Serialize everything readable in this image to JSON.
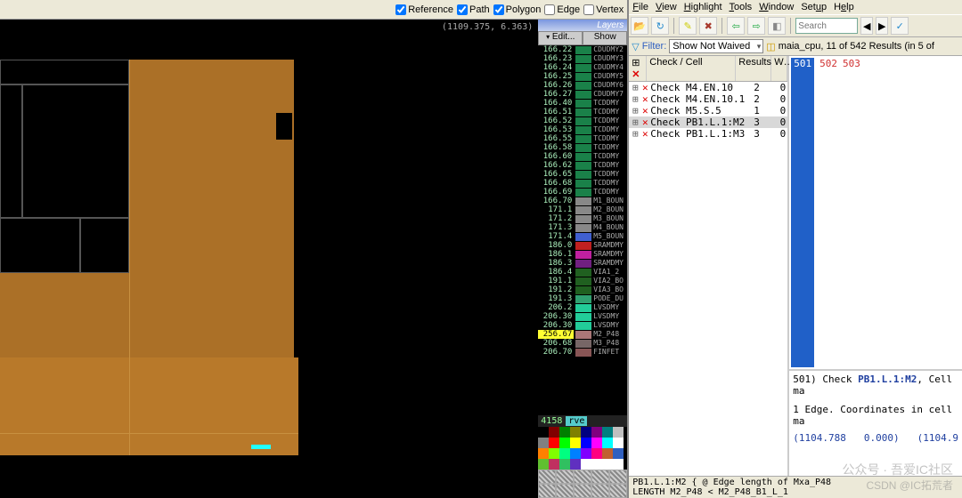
{
  "left": {
    "display_opts": [
      {
        "label": "Reference",
        "checked": true
      },
      {
        "label": "Path",
        "checked": true
      },
      {
        "label": "Polygon",
        "checked": true
      },
      {
        "label": "Edge",
        "checked": false
      },
      {
        "label": "Vertex",
        "checked": false
      }
    ],
    "coords": "(1109.375, 6.363)",
    "layers_title": "Layers",
    "layer_tabs": [
      "Edit...",
      "Show"
    ],
    "layer_rows": [
      {
        "n": "166.22",
        "c": "#1a8149",
        "nm": "CDUDMY2"
      },
      {
        "n": "166.23",
        "c": "#1a8149",
        "nm": "CDUDMY3"
      },
      {
        "n": "166.24",
        "c": "#1a8149",
        "nm": "CDUDMY4"
      },
      {
        "n": "166.25",
        "c": "#1a8149",
        "nm": "CDUDMY5"
      },
      {
        "n": "166.26",
        "c": "#1a8149",
        "nm": "CDUDMY6"
      },
      {
        "n": "166.27",
        "c": "#1a8149",
        "nm": "CDUDMY7"
      },
      {
        "n": "166.40",
        "c": "#1a8149",
        "nm": "TCDDMY"
      },
      {
        "n": "166.51",
        "c": "#1a8149",
        "nm": "TCDDMY"
      },
      {
        "n": "166.52",
        "c": "#1a8149",
        "nm": "TCDDMY"
      },
      {
        "n": "166.53",
        "c": "#1a8149",
        "nm": "TCDDMY"
      },
      {
        "n": "166.55",
        "c": "#1a8149",
        "nm": "TCDDMY"
      },
      {
        "n": "166.58",
        "c": "#1a8149",
        "nm": "TCDDMY"
      },
      {
        "n": "166.60",
        "c": "#1a8149",
        "nm": "TCDDMY"
      },
      {
        "n": "166.62",
        "c": "#1a8149",
        "nm": "TCDDMY"
      },
      {
        "n": "166.65",
        "c": "#1a8149",
        "nm": "TCDDMY"
      },
      {
        "n": "166.68",
        "c": "#1a8149",
        "nm": "TCDDMY"
      },
      {
        "n": "166.69",
        "c": "#1a8149",
        "nm": "TCDDMY"
      },
      {
        "n": "166.70",
        "c": "#888",
        "nm": "M1_BOUN"
      },
      {
        "n": "171.1",
        "c": "#888",
        "nm": "M2_BOUN"
      },
      {
        "n": "171.2",
        "c": "#888",
        "nm": "M3_BOUN"
      },
      {
        "n": "171.3",
        "c": "#888",
        "nm": "M4_BOUN"
      },
      {
        "n": "171.4",
        "c": "#4060d0",
        "nm": "M5_BOUN"
      },
      {
        "n": "186.0",
        "c": "#c02020",
        "nm": "SRAMDMY"
      },
      {
        "n": "186.1",
        "c": "#c020a0",
        "nm": "SRAMDMY"
      },
      {
        "n": "186.3",
        "c": "#702080",
        "nm": "SRAMDMY"
      },
      {
        "n": "186.4",
        "c": "#206020",
        "nm": "VIA1_2"
      },
      {
        "n": "191.1",
        "c": "#206020",
        "nm": "VIA2_BO"
      },
      {
        "n": "191.2",
        "c": "#206020",
        "nm": "VIA3_BO"
      },
      {
        "n": "191.3",
        "c": "#30a070",
        "nm": "PODE_DU"
      },
      {
        "n": "206.2",
        "c": "#2c9",
        "nm": "LVSDMY"
      },
      {
        "n": "206.30",
        "c": "#2c9",
        "nm": "LVSDMY"
      },
      {
        "n": "206.30",
        "c": "#2c9",
        "nm": "LVSDMY"
      },
      {
        "n": "256.67",
        "c": "#a77",
        "nm": "M2_P48",
        "sel": true
      },
      {
        "n": "206.68",
        "c": "#766",
        "nm": "M3_P48"
      },
      {
        "n": "206.70",
        "c": "#855",
        "nm": "FINFET"
      }
    ],
    "layer_count": "4158",
    "layer_count_tag": "rve",
    "palette": [
      "#000",
      "#800000",
      "#008000",
      "#808000",
      "#000080",
      "#800080",
      "#008080",
      "#c0c0c0",
      "#808080",
      "#ff0000",
      "#00ff00",
      "#ffff00",
      "#0000ff",
      "#ff00ff",
      "#00ffff",
      "#ffffff",
      "#ff8000",
      "#80ff00",
      "#00ff80",
      "#0080ff",
      "#8000ff",
      "#ff0080",
      "#c06030",
      "#3060c0",
      "#60c030",
      "#c03060",
      "#30c060",
      "#6030c0",
      "#fff",
      "#fff",
      "#fff",
      "#fff"
    ]
  },
  "rve": {
    "menus": [
      "File",
      "View",
      "Highlight",
      "Tools",
      "Window",
      "Setup",
      "Help"
    ],
    "toolbar_icons": [
      "folder-open-icon",
      "refresh-icon",
      "highlight-icon",
      "erase-icon",
      "zoom-fit-icon",
      "arrow-prev-icon",
      "arrow-next-icon",
      "unhilite-icon"
    ],
    "search_placeholder": "Search",
    "nav_icons": [
      "nav-prev-icon",
      "nav-next-icon",
      "waive-icon"
    ],
    "filter_label": "Filter:",
    "filter_value": "Show Not Waived",
    "cell_icon": "cell-icon",
    "context": "maia_cpu, 11 of 542 Results (in 5 of",
    "check_header": {
      "col1": "Check / Cell",
      "col2": "Results",
      "col3": "W…"
    },
    "checks": [
      {
        "name": "Check M4.EN.10",
        "res": "2",
        "w": "0"
      },
      {
        "name": "Check M4.EN.10.1",
        "res": "2",
        "w": "0"
      },
      {
        "name": "Check M5.S.5",
        "res": "1",
        "w": "0"
      },
      {
        "name": "Check PB1.L.1:M2",
        "res": "3",
        "w": "0",
        "sel": true
      },
      {
        "name": "Check PB1.L.1:M3",
        "res": "3",
        "w": "0"
      }
    ],
    "result_ids": [
      "501",
      "502",
      "503"
    ],
    "detail_line1": "501) Check PB1.L.1:M2, Cell ma",
    "detail_line2": "1 Edge. Coordinates in cell ma",
    "detail_coords": [
      "(1104.788",
      "0.000)",
      "(1104.9"
    ],
    "status": "PB1.L.1:M2 { @ Edge length of Mxa_P48\n  LENGTH M2_P48 < M2_P48_B1_L_1",
    "watermark1": "公众号 · 吾爱IC社区",
    "watermark2": "CSDN @IC拓荒者"
  }
}
